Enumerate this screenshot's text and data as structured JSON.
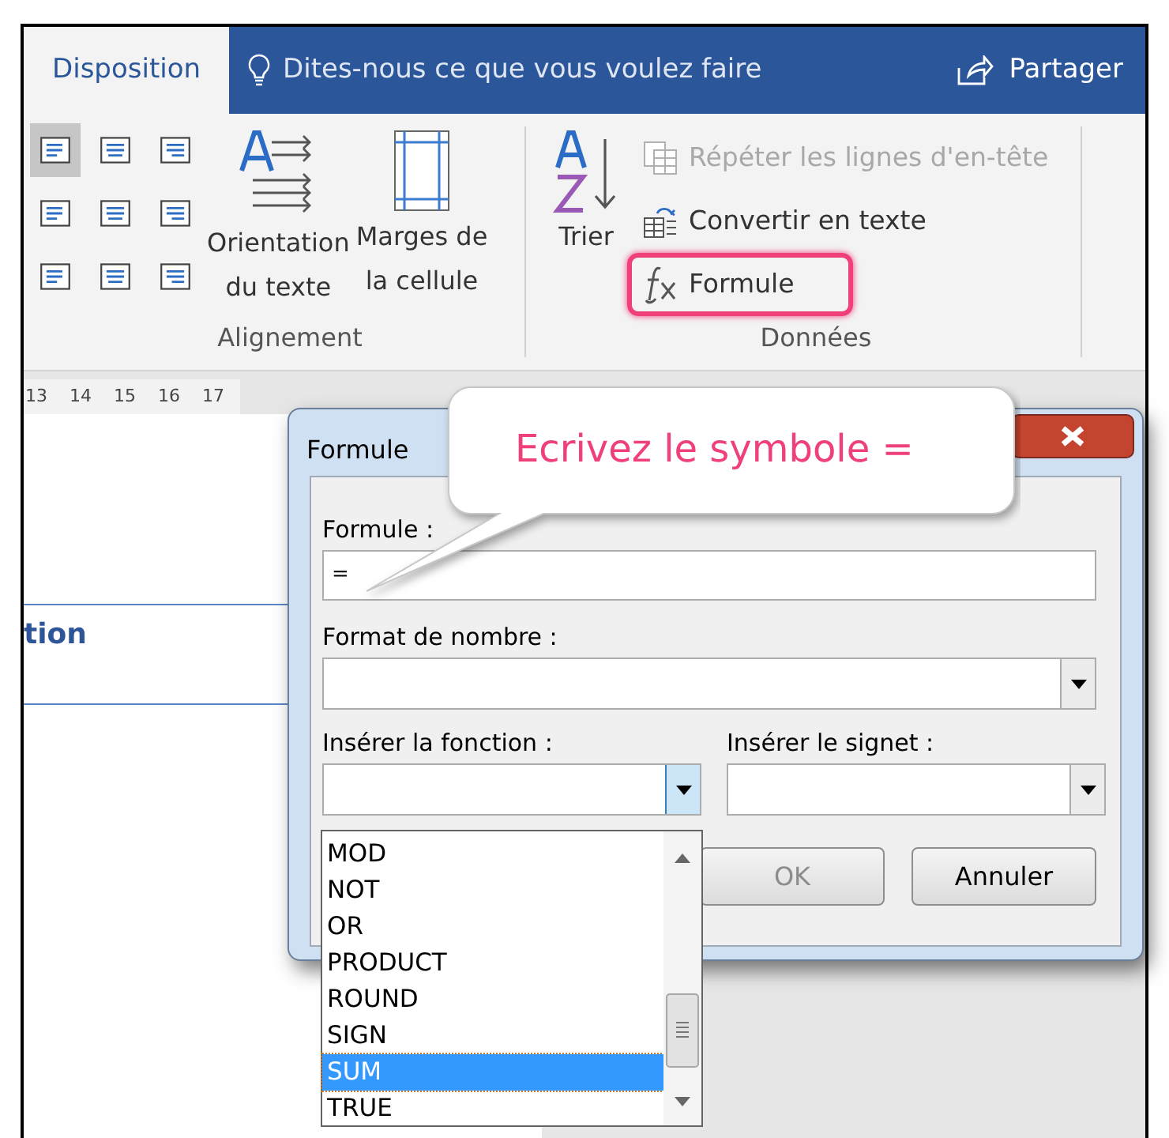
{
  "tabs": [
    {
      "label": "Disposition",
      "selected": true
    }
  ],
  "tell_me": {
    "placeholder": "Dites-nous ce que vous voulez faire"
  },
  "share_button": {
    "label": "Partager"
  },
  "alignment_group": {
    "label": "Alignement",
    "align_buttons": [
      {
        "selected": true
      },
      {
        "selected": false
      },
      {
        "selected": false
      },
      {
        "selected": false
      },
      {
        "selected": false
      },
      {
        "selected": false
      },
      {
        "selected": false
      },
      {
        "selected": false
      },
      {
        "selected": false
      }
    ],
    "buttons": [
      {
        "kind": "orientation",
        "label": "Orientation\ndu texte"
      },
      {
        "kind": "margins",
        "label": "Marges de\nla cellule"
      }
    ]
  },
  "data_group": {
    "label": "Données",
    "sort_button": {
      "label": "Trier"
    },
    "commands": [
      {
        "kind": "repeat",
        "label": "Répéter les lignes d'en-tête",
        "disabled": true,
        "highlighted": false
      },
      {
        "kind": "convert",
        "label": "Convertir en texte",
        "disabled": false,
        "highlighted": false
      },
      {
        "kind": "formula",
        "label": "Formule",
        "disabled": false,
        "highlighted": true
      }
    ]
  },
  "ruler": [
    "13",
    "14",
    "15",
    "16",
    "17"
  ],
  "document": {
    "heading_fragment": "tion"
  },
  "dialog": {
    "title": "Formule",
    "formula_label": "Formule :",
    "formula_value": "=",
    "number_format_label": "Format de nombre :",
    "function_label": "Insérer la fonction :",
    "bookmark_label": "Insérer le signet :",
    "function_list": [
      {
        "label": "MOD",
        "selected": false
      },
      {
        "label": "NOT",
        "selected": false
      },
      {
        "label": "OR",
        "selected": false
      },
      {
        "label": "PRODUCT",
        "selected": false
      },
      {
        "label": "ROUND",
        "selected": false
      },
      {
        "label": "SIGN",
        "selected": false
      },
      {
        "label": "SUM",
        "selected": true
      },
      {
        "label": "TRUE",
        "selected": false
      }
    ],
    "buttons": [
      {
        "label": "OK",
        "disabled": true
      },
      {
        "label": "Annuler",
        "disabled": false
      }
    ]
  },
  "callout": {
    "text": "Ecrivez le symbole ="
  }
}
